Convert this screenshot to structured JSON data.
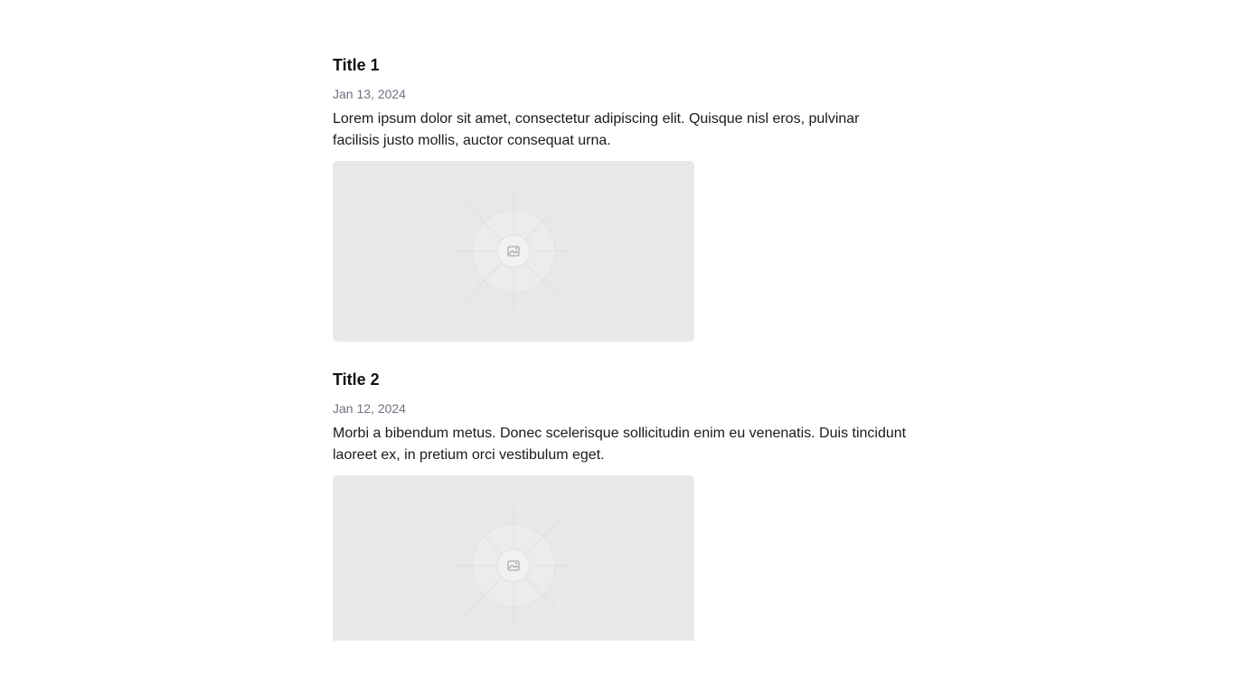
{
  "posts": [
    {
      "title": "Title 1",
      "date": "Jan 13, 2024",
      "body": "Lorem ipsum dolor sit amet, consectetur adipiscing elit. Quisque nisl eros, pulvinar facilisis justo mollis, auctor consequat urna.",
      "image_icon": "image-placeholder-icon"
    },
    {
      "title": "Title 2",
      "date": "Jan 12, 2024",
      "body": "Morbi a bibendum metus. Donec scelerisque sollicitudin enim eu venenatis. Duis tincidunt laoreet ex, in pretium orci vestibulum eget.",
      "image_icon": "image-placeholder-icon"
    }
  ],
  "colors": {
    "title": "#111111",
    "date": "#6b7280",
    "body": "#1a1a1a",
    "placeholder_bg": "#e8e8e8"
  }
}
